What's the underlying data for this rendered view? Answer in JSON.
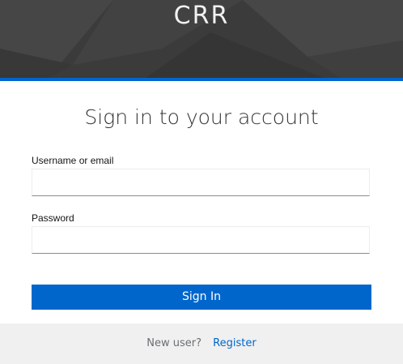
{
  "header": {
    "brand": "CRR"
  },
  "login": {
    "title": "Sign in to your account",
    "username_label": "Username or email",
    "username_value": "",
    "password_label": "Password",
    "password_value": "",
    "submit_label": "Sign In"
  },
  "footer": {
    "new_user_text": "New user?",
    "register_link": "Register"
  },
  "colors": {
    "accent": "#0066cc",
    "header_bg": "#3e3e3e",
    "footer_bg": "#f0f0f0"
  }
}
